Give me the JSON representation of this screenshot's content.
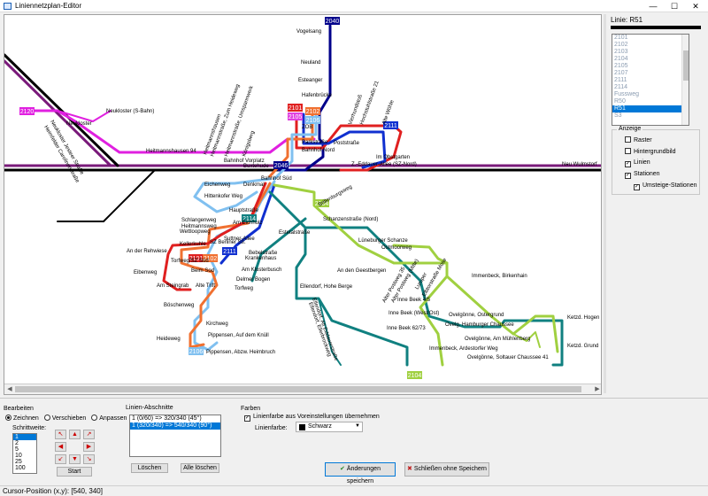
{
  "window": {
    "title": "Liniennetzplan-Editor",
    "minimize": "—",
    "maximize": "☐",
    "close": "✕"
  },
  "map": {
    "route_badges": [
      {
        "text": "2040",
        "color": "#00008b"
      },
      {
        "text": "2120",
        "color": "#e020e0"
      },
      {
        "text": "2101",
        "color": "#e02020"
      },
      {
        "text": "2105",
        "color": "#e040e0"
      },
      {
        "text": "2102",
        "color": "#f07030"
      },
      {
        "text": "2106",
        "color": "#80c0f0"
      },
      {
        "text": "2111",
        "color": "#1030d0"
      },
      {
        "text": "2046",
        "color": "#00008b"
      },
      {
        "text": "2104",
        "color": "#a0d040"
      },
      {
        "text": "2114",
        "color": "#108080"
      },
      {
        "text": "2101",
        "color": "#e02020"
      },
      {
        "text": "2102",
        "color": "#f07030"
      },
      {
        "text": "2111",
        "color": "#1030d0"
      },
      {
        "text": "2106",
        "color": "#80c0f0"
      },
      {
        "text": "2104",
        "color": "#a0d040"
      }
    ],
    "stations": [
      "Vogelsang",
      "Neuland",
      "Esteanger",
      "Hafenbrücke",
      "Neukloster (S-Bahn)",
      "Neukloster",
      "Neukloster Jesteer Straße",
      "Heimfelder Carolinenstraße",
      "Heitmannshausen 94",
      "Heitmannshausen",
      "Heitmannstraße, Zum Heideweg",
      "Heitmannstraße, Umspannwerk",
      "Königsberg",
      "Bahnhof Vorplatz",
      "Buxtehude",
      "ZOB",
      "Parkstraße",
      "Bahnhof Nord",
      "Poststraße",
      "Vierhundstoß",
      "Hochstuhlstraße 21",
      "Alte Wöhle",
      "Im Obstgarten",
      "Z.-Eddauer-Allee (SZ-Nord)",
      "Neu Wulmstorf",
      "Eichenweg",
      "Denkmal",
      "Bahnhof Süd",
      "Hittenkofer Weg",
      "Brillenburgsweg",
      "Hauptstraße",
      "Am Eichholz",
      "Schanzenstraße (Nord)",
      "Schlangenweg",
      "Heitmannsweg",
      "Wettloopweg",
      "Suttner-Allee",
      "Estetalstraße",
      "Lüneburger Schanze",
      "Ostmoorweg",
      "An der Rehwiese",
      "Kellerkuhle",
      "SZ Berliner Str.",
      "Bebelstraße",
      "Torfweg/SZ Süd",
      "Krankenhaus",
      "Am Klosterbusch",
      "Eibenweg",
      "Beim Sod",
      "Delmer Bogen",
      "Torfweg",
      "Am Steingrab",
      "Alte Trift",
      "An den Geestbergen",
      "Alter Postweg 35",
      "Alter Postweg (Mitte)",
      "Luruper",
      "Elbtorstraße Mose",
      "Immenbeck, Birkenhain",
      "Ellendorf, Hohe Berge",
      "Böschenweg",
      "Kirchweg",
      "Heideweg",
      "Pippensen, Auf dem Knüll",
      "Pippensen, Abzw. Heimbruch",
      "Ellendorf, Ellerbrockweg",
      "Ellendorf, Alt Eddauerstraße",
      "Inne Beek 4/5",
      "Inne Beek (West/Ost)",
      "Inne Beek 62/73",
      "Ovelgönne, Ostergrund",
      "Ovelg. Hamburger Chaussee",
      "Ovelgönne, Am Mühlenberg",
      "Immenbeck, Ardestorfer Weg",
      "Ovelgönne, Soltauer Chaussee 41",
      "Ketzd. Hogen",
      "Ketzd. Grund"
    ]
  },
  "right": {
    "line_label": "Linie: R51",
    "lines": [
      "2101",
      "2102",
      "2103",
      "2104",
      "2105",
      "2107",
      "2111",
      "2114",
      "Fussweg",
      "R50",
      "R51",
      "S3"
    ],
    "selected_index": 10,
    "anzeige_title": "Anzeige",
    "options": [
      {
        "label": "Raster",
        "checked": false
      },
      {
        "label": "Hintergrundbild",
        "checked": false
      },
      {
        "label": "Linien",
        "checked": true
      },
      {
        "label": "Stationen",
        "checked": true
      },
      {
        "label": "Umsteige-Stationen",
        "checked": true
      }
    ]
  },
  "bearbeiten": {
    "title": "Bearbeiten",
    "modes": [
      {
        "label": "Zeichnen",
        "on": true
      },
      {
        "label": "Verschieben",
        "on": false
      },
      {
        "label": "Anpassen",
        "on": false
      }
    ],
    "step_label": "Schrittweite:",
    "steps": [
      "1",
      "2",
      "5",
      "10",
      "25",
      "100"
    ],
    "start": "Start"
  },
  "abschnitte": {
    "title": "Linien-Abschnitte",
    "items": [
      "1 (0/60) => 320/340 (45°)",
      "1 (320/340) => 540/340 (90°)"
    ],
    "delete": "Löschen",
    "delete_all": "Alle löschen"
  },
  "farben": {
    "title": "Farben",
    "preset_label": "Linienfarbe aus Voreinstellungen übernehmen",
    "preset_checked": true,
    "color_label": "Linienfarbe:",
    "color_value": "Schwarz"
  },
  "actions": {
    "save": "Änderungen speichern",
    "close": "Schließen ohne Speichern"
  },
  "status": "Cursor-Position (x,y): [540, 340]"
}
